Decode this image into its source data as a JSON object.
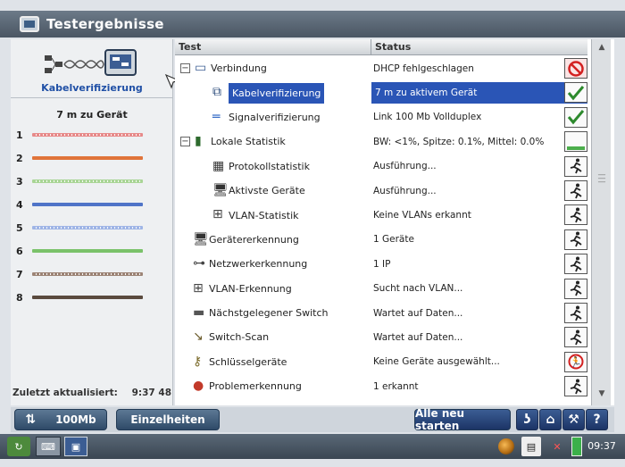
{
  "window": {
    "title": "Testergebnisse"
  },
  "left_panel": {
    "tab_label": "Kabelverifizierung",
    "distance": "7 m zu Gerät",
    "pairs": [
      {
        "num": "1",
        "color": "#e78a8a",
        "style": "dashed"
      },
      {
        "num": "2",
        "color": "#e0743a",
        "style": "solid"
      },
      {
        "num": "3",
        "color": "#a9d596",
        "style": "dashed"
      },
      {
        "num": "4",
        "color": "#4f74c8",
        "style": "solid"
      },
      {
        "num": "5",
        "color": "#9fb5e6",
        "style": "dashed"
      },
      {
        "num": "6",
        "color": "#7ac26a",
        "style": "solid"
      },
      {
        "num": "7",
        "color": "#9c8476",
        "style": "dashed"
      },
      {
        "num": "8",
        "color": "#5a4a3e",
        "style": "solid"
      }
    ],
    "last_update_label": "Zuletzt aktualisiert:",
    "last_update_time": "9:37 48"
  },
  "table": {
    "col_test": "Test",
    "col_status": "Status",
    "rows": [
      {
        "test": "Verbindung",
        "status": "DHCP fehlgeschlagen",
        "level": 0,
        "expander": "−",
        "icon": "monitor-icon",
        "result": "fail"
      },
      {
        "test": "Kabelverifizierung",
        "status": "7 m zu aktivem Gerät",
        "level": 1,
        "icon": "cable-icon",
        "result": "pass",
        "selected": true
      },
      {
        "test": "Signalverifizierung",
        "status": "Link 100 Mb Vollduplex",
        "level": 1,
        "icon": "signal-icon",
        "result": "pass"
      },
      {
        "test": "Lokale Statistik",
        "status": "BW: <1%, Spitze: 0.1%, Mittel: 0.0%",
        "level": 0,
        "expander": "−",
        "icon": "stats-icon",
        "result": "progress"
      },
      {
        "test": "Protokollstatistik",
        "status": "Ausführung...",
        "level": 1,
        "icon": "protocol-icon",
        "result": "running"
      },
      {
        "test": "Aktivste Geräte",
        "status": "Ausführung...",
        "level": 1,
        "icon": "computer-icon",
        "result": "running"
      },
      {
        "test": "VLAN-Statistik",
        "status": "Keine VLANs erkannt",
        "level": 1,
        "icon": "vlan-icon",
        "result": "running"
      },
      {
        "test": "Gerätererkennung",
        "status": "1 Geräte",
        "level": 0,
        "icon": "computer-icon",
        "result": "running"
      },
      {
        "test": "Netzwerkerkennung",
        "status": "1 IP",
        "level": 0,
        "icon": "network-icon",
        "result": "running"
      },
      {
        "test": "VLAN-Erkennung",
        "status": "Sucht nach VLAN...",
        "level": 0,
        "icon": "vlan-icon",
        "result": "running"
      },
      {
        "test": "Nächstgelegener Switch",
        "status": "Wartet auf Daten...",
        "level": 0,
        "icon": "switch-icon",
        "result": "running"
      },
      {
        "test": "Switch-Scan",
        "status": "Wartet auf Daten...",
        "level": 0,
        "icon": "scan-icon",
        "result": "running"
      },
      {
        "test": "Schlüsselgeräte",
        "status": "Keine Geräte ausgewählt...",
        "level": 0,
        "icon": "key-icon",
        "result": "blocked"
      },
      {
        "test": "Problemerkennung",
        "status": "1 erkannt",
        "level": 0,
        "icon": "problem-icon",
        "result": "running"
      }
    ]
  },
  "buttons": {
    "speed": "100Mb",
    "details": "Einzelheiten",
    "restart_all": "Alle neu starten"
  },
  "taskbar": {
    "clock": "09:37"
  }
}
